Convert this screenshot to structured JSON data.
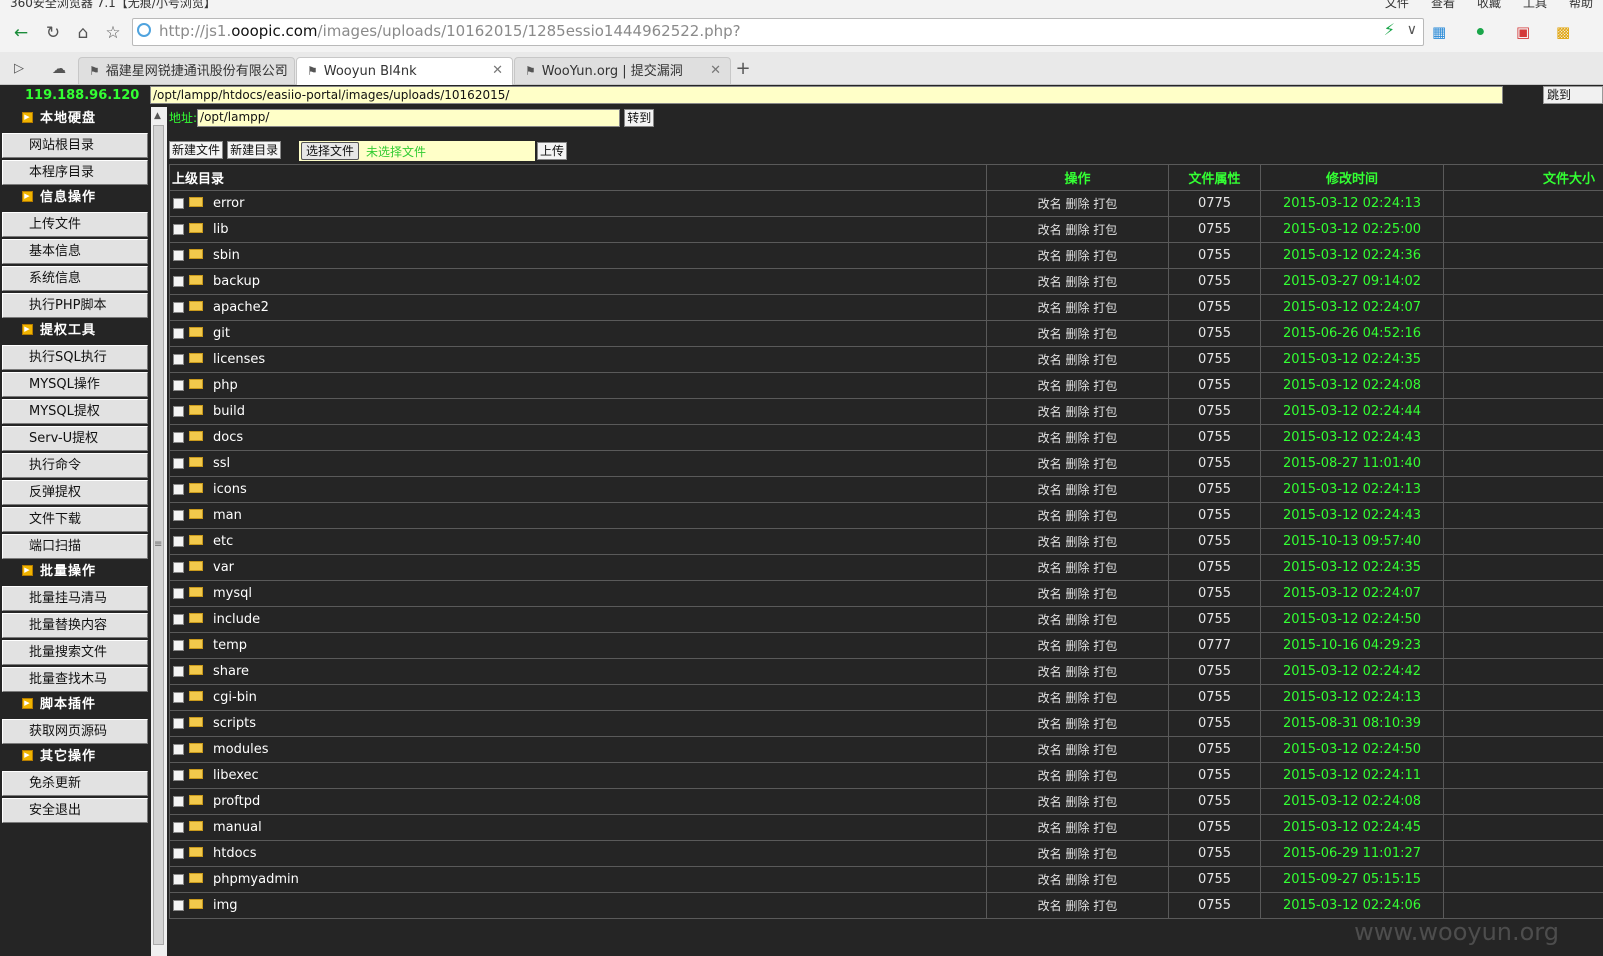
{
  "browser": {
    "title": "360安全浏览器 7.1【无痕/小号浏览】",
    "menus": [
      "文件",
      "查看",
      "收藏",
      "工具",
      "帮助"
    ],
    "url_prefix": "http://js1.",
    "url_domain": "ooopic.com",
    "url_path": "/images/uploads/10162015/1285essio1444962522.php?",
    "tabs": [
      {
        "label": "福建星网锐捷通讯股份有限公司"
      },
      {
        "label": "Wooyun Bl4nk"
      },
      {
        "label": "WooYun.org | 提交漏洞"
      }
    ]
  },
  "shell": {
    "ip": "119.188.96.120",
    "path": "/opt/lampp/htdocs/easiio-portal/images/uploads/10162015/",
    "jump_label": "跳到",
    "address_label": "地址:",
    "address_value": "/opt/lampp/",
    "go_label": "转到",
    "new_file_label": "新建文件",
    "new_dir_label": "新建目录",
    "choose_file_label": "选择文件",
    "no_file_label": "未选择文件",
    "upload_label": "上传"
  },
  "sidebar": {
    "sections": [
      {
        "title": "本地硬盘",
        "items": [
          "网站根目录",
          "本程序目录"
        ]
      },
      {
        "title": "信息操作",
        "items": [
          "上传文件",
          "基本信息",
          "系统信息",
          "执行PHP脚本"
        ]
      },
      {
        "title": "提权工具",
        "items": [
          "执行SQL执行",
          "MYSQL操作",
          "MYSQL提权",
          "Serv-U提权",
          "执行命令",
          "反弹提权",
          "文件下载",
          "端口扫描"
        ]
      },
      {
        "title": "批量操作",
        "items": [
          "批量挂马清马",
          "批量替换内容",
          "批量搜索文件",
          "批量查找木马"
        ]
      },
      {
        "title": "脚本插件",
        "items": [
          "获取网页源码"
        ]
      },
      {
        "title": "其它操作",
        "items": [
          "免杀更新",
          "安全退出"
        ]
      }
    ]
  },
  "table": {
    "headers": {
      "name": "上级目录",
      "ops": "操作",
      "perm": "文件属性",
      "time": "修改时间",
      "size": "文件大小"
    },
    "ops_label": "改名 删除 打包",
    "rows": [
      {
        "name": "error",
        "perm": "0775",
        "time": "2015-03-12 02:24:13"
      },
      {
        "name": "lib",
        "perm": "0755",
        "time": "2015-03-12 02:25:00"
      },
      {
        "name": "sbin",
        "perm": "0755",
        "time": "2015-03-12 02:24:36"
      },
      {
        "name": "backup",
        "perm": "0755",
        "time": "2015-03-27 09:14:02"
      },
      {
        "name": "apache2",
        "perm": "0755",
        "time": "2015-03-12 02:24:07"
      },
      {
        "name": "git",
        "perm": "0755",
        "time": "2015-06-26 04:52:16"
      },
      {
        "name": "licenses",
        "perm": "0755",
        "time": "2015-03-12 02:24:35"
      },
      {
        "name": "php",
        "perm": "0755",
        "time": "2015-03-12 02:24:08"
      },
      {
        "name": "build",
        "perm": "0755",
        "time": "2015-03-12 02:24:44"
      },
      {
        "name": "docs",
        "perm": "0755",
        "time": "2015-03-12 02:24:43"
      },
      {
        "name": "ssl",
        "perm": "0755",
        "time": "2015-08-27 11:01:40"
      },
      {
        "name": "icons",
        "perm": "0755",
        "time": "2015-03-12 02:24:13"
      },
      {
        "name": "man",
        "perm": "0755",
        "time": "2015-03-12 02:24:43"
      },
      {
        "name": "etc",
        "perm": "0755",
        "time": "2015-10-13 09:57:40"
      },
      {
        "name": "var",
        "perm": "0755",
        "time": "2015-03-12 02:24:35"
      },
      {
        "name": "mysql",
        "perm": "0755",
        "time": "2015-03-12 02:24:07"
      },
      {
        "name": "include",
        "perm": "0755",
        "time": "2015-03-12 02:24:50"
      },
      {
        "name": "temp",
        "perm": "0777",
        "time": "2015-10-16 04:29:23"
      },
      {
        "name": "share",
        "perm": "0755",
        "time": "2015-03-12 02:24:42"
      },
      {
        "name": "cgi-bin",
        "perm": "0755",
        "time": "2015-03-12 02:24:13"
      },
      {
        "name": "scripts",
        "perm": "0755",
        "time": "2015-08-31 08:10:39"
      },
      {
        "name": "modules",
        "perm": "0755",
        "time": "2015-03-12 02:24:50"
      },
      {
        "name": "libexec",
        "perm": "0755",
        "time": "2015-03-12 02:24:11"
      },
      {
        "name": "proftpd",
        "perm": "0755",
        "time": "2015-03-12 02:24:08"
      },
      {
        "name": "manual",
        "perm": "0755",
        "time": "2015-03-12 02:24:45"
      },
      {
        "name": "htdocs",
        "perm": "0755",
        "time": "2015-06-29 11:01:27"
      },
      {
        "name": "phpmyadmin",
        "perm": "0755",
        "time": "2015-09-27 05:15:15"
      },
      {
        "name": "img",
        "perm": "0755",
        "time": "2015-03-12 02:24:06"
      }
    ]
  },
  "watermark": "www.wooyun.org",
  "colors": {
    "accent_green": "#33ff33",
    "background": "#252525",
    "input_yellow": "#ffffc8",
    "folder": "#f2c94c"
  }
}
